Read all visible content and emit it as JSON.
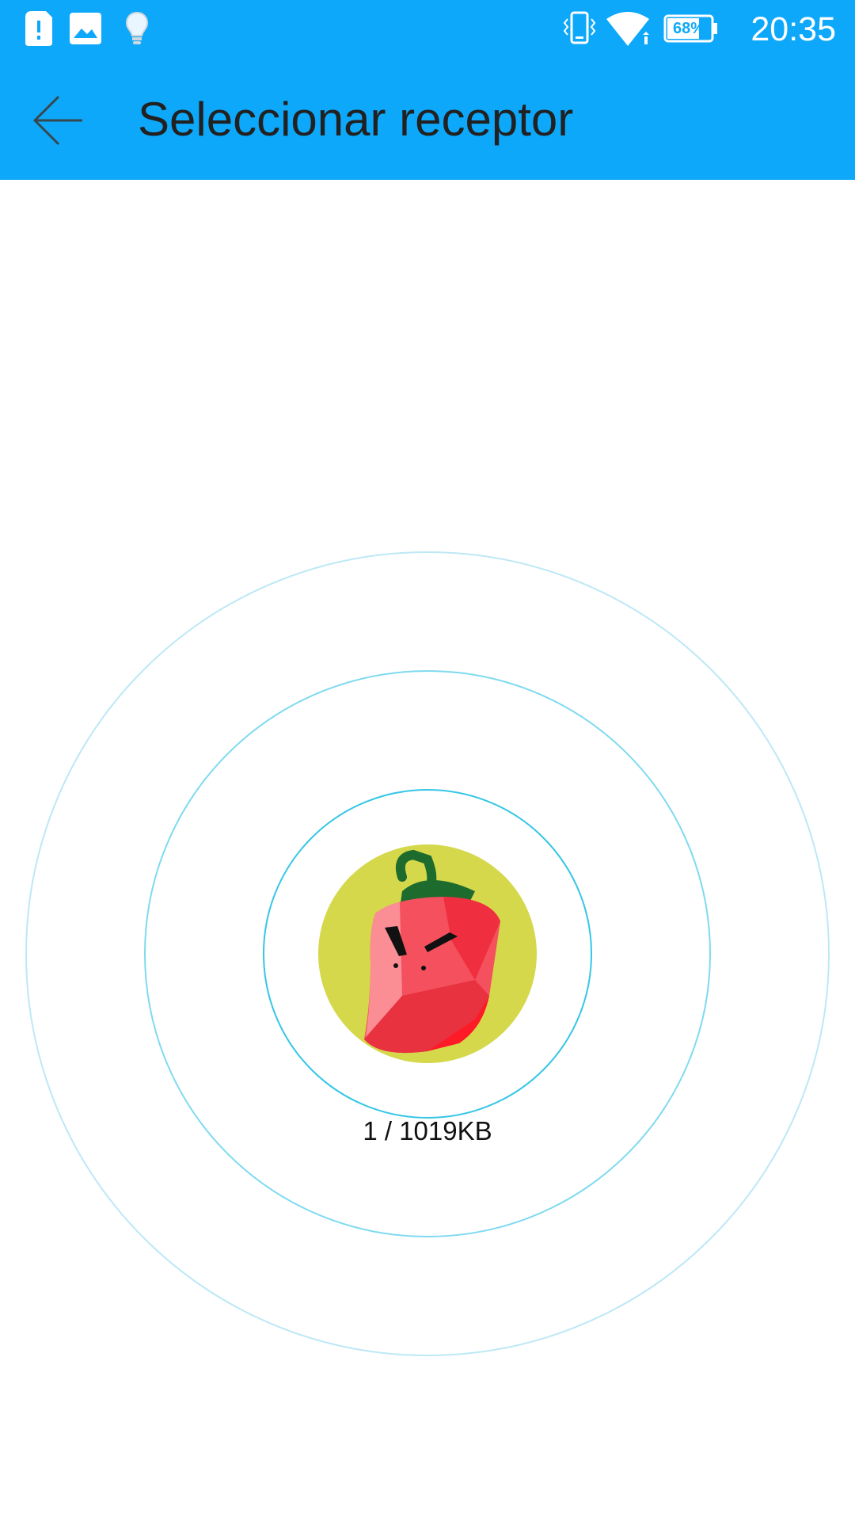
{
  "status_bar": {
    "time": "20:35",
    "battery_percent": "68%",
    "icons": [
      "sim-alert-icon",
      "image-icon",
      "lightbulb-icon",
      "vibrate-icon",
      "wifi-icon",
      "battery-icon"
    ]
  },
  "header": {
    "title": "Seleccionar receptor",
    "back_icon": "arrow-left-icon"
  },
  "main": {
    "avatar_icon": "red-pepper-avatar",
    "transfer_info": "1 / 1019KB"
  },
  "colors": {
    "accent": "#0ea8fa",
    "ring": "#3ccde6",
    "avatar_bg": "#d4d84a",
    "pepper": "#f0384a",
    "stem": "#1e6b2e"
  }
}
